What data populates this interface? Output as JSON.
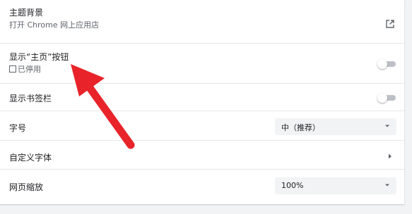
{
  "settings": {
    "theme": {
      "title": "主题背景",
      "subtitle": "打开 Chrome 网上应用店",
      "icon": "open-external-icon"
    },
    "home_button": {
      "title": "显示“主页”按钮",
      "subtitle": "已停用",
      "enabled": false
    },
    "bookmarks_bar": {
      "title": "显示书签栏",
      "enabled": false
    },
    "font_size": {
      "label": "字号",
      "value": "中（推荐）"
    },
    "custom_fonts": {
      "label": "自定义字体"
    },
    "page_zoom": {
      "label": "网页缩放",
      "value": "100%"
    }
  },
  "annotation": {
    "arrow_color": "#e8242a"
  }
}
